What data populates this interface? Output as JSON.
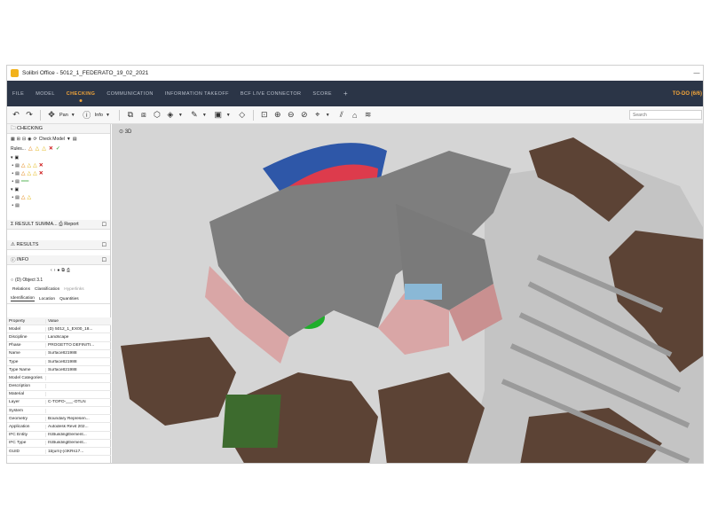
{
  "window": {
    "title": "Solibri Office - 5012_1_FEDERATO_19_02_2021"
  },
  "menu": {
    "items": [
      "FILE",
      "MODEL",
      "CHECKING",
      "COMMUNICATION",
      "INFORMATION TAKEOFF",
      "BCF LIVE CONNECTOR",
      "SCORE"
    ],
    "active": "CHECKING",
    "plus": "+",
    "todo": "TO-DO (6/6)"
  },
  "toolbar": {
    "pan": "Pan",
    "info": "Info",
    "search_placeholder": "Search"
  },
  "checking": {
    "title": "CHECKING",
    "check_model": "Check Model",
    "rules_label": "Rules..."
  },
  "result_summary": {
    "title": "RESULT SUMMA...",
    "report": "Report"
  },
  "results": {
    "title": "RESULTS"
  },
  "info": {
    "title": "INFO",
    "object": "(D) Object 3.1",
    "tabs_row1": [
      "Relations",
      "Classification",
      "Hyperlinks"
    ],
    "tabs_row2": [
      "Identification",
      "Location",
      "Quantities"
    ],
    "header": [
      "Property",
      "Value"
    ],
    "rows": [
      [
        "Model",
        "(D) 5012_1_EX00_18..."
      ],
      [
        "Discipline",
        "Landscape"
      ],
      [
        "Phase",
        "PROGETTO DEFINITI..."
      ],
      [
        "Name",
        "Surface821988"
      ],
      [
        "Type",
        "Surface821988"
      ],
      [
        "Type Name",
        "Surface821988"
      ],
      [
        "Model Categories",
        ""
      ],
      [
        "Description",
        ""
      ],
      [
        "Material",
        ""
      ],
      [
        "Layer",
        "C-TOPO-___-OTLN"
      ],
      [
        "System",
        ""
      ],
      [
        "Geometry",
        "Boundary Represen..."
      ],
      [
        "Application",
        "Autodesk Revit 202..."
      ],
      [
        "IFC Entity",
        "IfcBuildingElement..."
      ],
      [
        "IFC Type",
        "IfcBuildingElement..."
      ],
      [
        "GUID",
        "1b[urn]-(ctKRs17..."
      ]
    ]
  },
  "viewport": {
    "label": "3D"
  },
  "colors": {
    "menubar": "#2b3547",
    "accent": "#f0a43a",
    "terrain": "#5c4335",
    "roof": "#7e7e7e",
    "facade": "#d9a6a6",
    "pavement": "#bfbfbf"
  }
}
